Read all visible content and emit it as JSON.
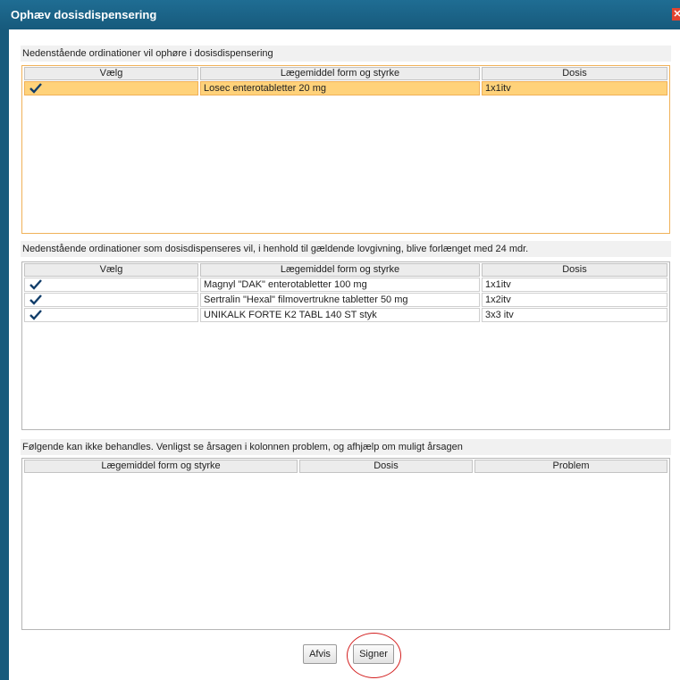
{
  "dialog": {
    "title": "Ophæv dosisdispensering"
  },
  "section1": {
    "label": "Nedenstående ordinationer vil ophøre i dosisdispensering",
    "columns": [
      "Vælg",
      "Lægemiddel form og styrke",
      "Dosis"
    ],
    "rows": [
      {
        "checked": true,
        "drug": "Losec enterotabletter 20 mg",
        "dose": "1x1itv"
      }
    ]
  },
  "section2": {
    "label": "Nedenstående ordinationer som dosisdispenseres vil, i henhold til gældende lovgivning, blive forlænget med 24 mdr.",
    "columns": [
      "Vælg",
      "Lægemiddel form og styrke",
      "Dosis"
    ],
    "rows": [
      {
        "checked": true,
        "drug": "Magnyl \"DAK\" enterotabletter 100 mg",
        "dose": "1x1itv"
      },
      {
        "checked": true,
        "drug": "Sertralin \"Hexal\" filmovertrukne tabletter 50 mg",
        "dose": "1x2itv"
      },
      {
        "checked": true,
        "drug": "UNIKALK FORTE K2 TABL 140 ST styk",
        "dose": "3x3 itv"
      }
    ]
  },
  "section3": {
    "label": "Følgende kan ikke behandles. Venligst se årsagen i kolonnen problem, og afhjælp om muligt årsagen",
    "columns": [
      "Lægemiddel form og styrke",
      "Dosis",
      "Problem"
    ]
  },
  "buttons": {
    "reject_label": "Afvis",
    "sign_label": "Signer"
  },
  "colors": {
    "titlebar": "#175a7c",
    "selection": "#ffd27a",
    "highlight_ring": "#d31f1f"
  }
}
